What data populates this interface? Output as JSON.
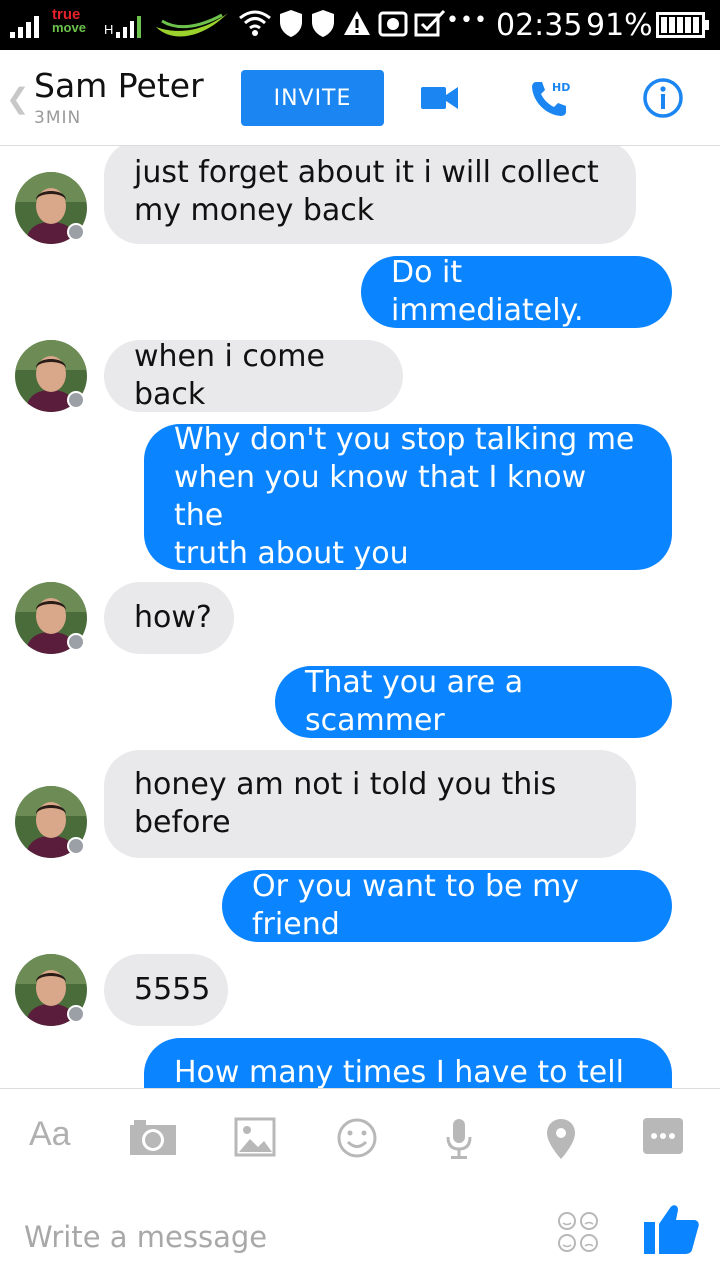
{
  "status_bar": {
    "carrier_line1": "true",
    "carrier_line2": "move",
    "network_h": "H",
    "time": "02:35",
    "battery_percent": "91%",
    "icons": [
      "signal-icon",
      "wifi-icon",
      "shield-icon",
      "shield-icon",
      "warning-icon",
      "camera-icon",
      "task-icon",
      "more-dots"
    ]
  },
  "header": {
    "contact_name": "Sam Peter",
    "contact_status": "3MIN",
    "invite_label": "INVITE",
    "phone_badge": "HD",
    "accent_color": "#1b86f2"
  },
  "messages": [
    {
      "direction": "incoming",
      "text_lines": [
        "just forget about it i will collect",
        "my money back"
      ]
    },
    {
      "direction": "outgoing",
      "text_lines": [
        "Do it immediately."
      ]
    },
    {
      "direction": "incoming",
      "text_lines": [
        "when i come back"
      ]
    },
    {
      "direction": "outgoing",
      "text_lines": [
        "Why don't you stop talking me",
        "when you know that I know the",
        "truth about you"
      ]
    },
    {
      "direction": "incoming",
      "text_lines": [
        "how?"
      ]
    },
    {
      "direction": "outgoing",
      "text_lines": [
        "That you are a scammer"
      ]
    },
    {
      "direction": "incoming",
      "text_lines": [
        "honey am not i told you this",
        "before"
      ]
    },
    {
      "direction": "outgoing",
      "text_lines": [
        "Or you want to be my friend"
      ]
    },
    {
      "direction": "incoming",
      "text_lines": [
        "5555"
      ]
    },
    {
      "direction": "outgoing",
      "text_lines": [
        "How many times I have to tell"
      ]
    }
  ],
  "composer": {
    "text_tool_label": "Aa",
    "placeholder": "Write a message",
    "tools": [
      "camera-icon",
      "image-icon",
      "emoji-icon",
      "microphone-icon",
      "location-icon",
      "more-icon"
    ]
  },
  "colors": {
    "outgoing_bubble": "#0a84ff",
    "incoming_bubble": "#e9e9eb",
    "status_bar": "#000000"
  }
}
